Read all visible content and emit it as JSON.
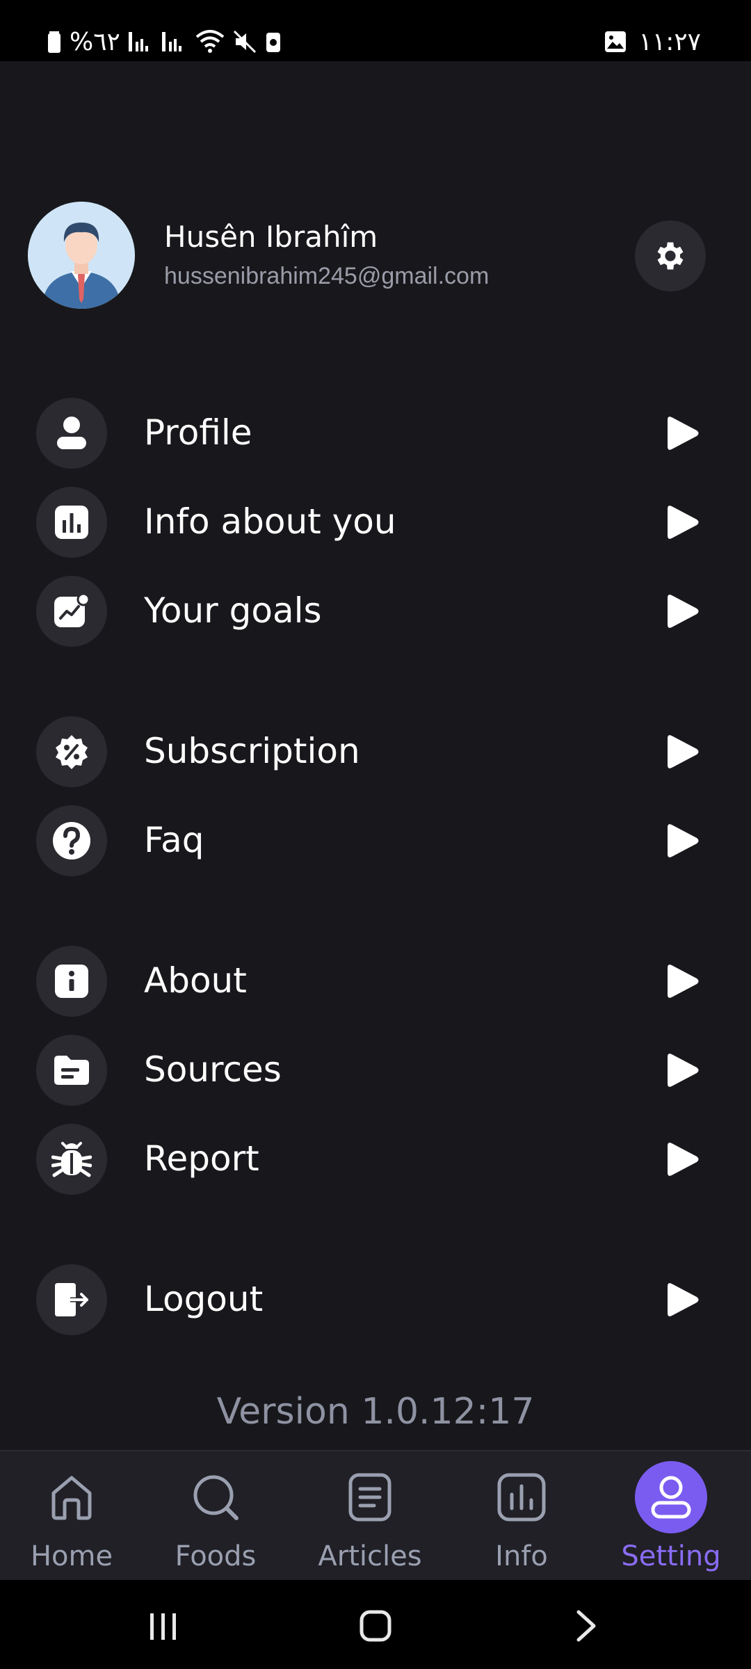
{
  "status_bar": {
    "battery": "%٦٢",
    "time": "١١:٢٧"
  },
  "user": {
    "name": "Husên Ibrahîm",
    "email": "hussenibrahim245@gmail.com"
  },
  "menu": {
    "profile": "Profile",
    "info_about_you": "Info about you",
    "your_goals": "Your goals",
    "subscription": "Subscription",
    "faq": "Faq",
    "about": "About",
    "sources": "Sources",
    "report": "Report",
    "logout": "Logout"
  },
  "version": "Version 1.0.12:17",
  "bottom_nav": {
    "home": "Home",
    "foods": "Foods",
    "articles": "Articles",
    "info": "Info",
    "setting": "Setting",
    "active": "Setting"
  },
  "colors": {
    "background": "#18181c",
    "accent": "#7b5cf0",
    "icon_bg": "#2a2a30",
    "muted_text": "#9a9ca8"
  }
}
